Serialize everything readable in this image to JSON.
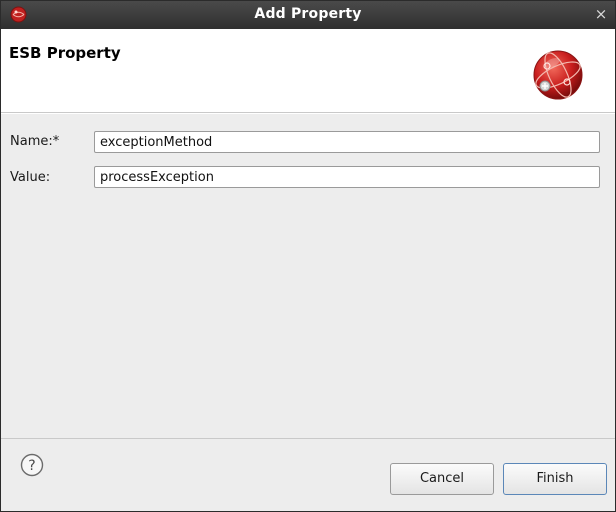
{
  "window": {
    "title": "Add Property",
    "close_glyph": "×",
    "app_icon": "eclipse-app-icon"
  },
  "banner": {
    "heading": "ESB Property",
    "icon": "esb-globe-icon"
  },
  "form": {
    "name_label": "Name:*",
    "name_value": "exceptionMethod",
    "value_label": "Value:",
    "value_value": "processException"
  },
  "footer": {
    "help_icon": "help-icon",
    "help_glyph": "?",
    "cancel_label": "Cancel",
    "finish_label": "Finish"
  },
  "colors": {
    "titlebar": "#3a3a3a",
    "dialog_background": "#ededed",
    "banner_background": "#ffffff",
    "icon_red": "#c0201f",
    "finish_border": "#5b87b8"
  }
}
